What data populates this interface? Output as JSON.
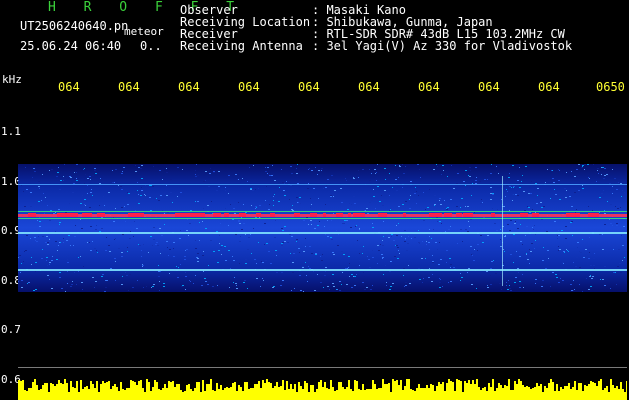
{
  "header": {
    "app_name": "H R O F F T",
    "filename": "UT2506240640.pn",
    "meteor_label": "meteor",
    "date_time": "25.06.24 06:40",
    "count_text": "0..",
    "fields": [
      {
        "label": "Observer",
        "value": ": Masaki Kano"
      },
      {
        "label": "Receiving Location",
        "value": ": Shibukawa, Gunma, Japan"
      },
      {
        "label": "Receiver",
        "value": ": RTL-SDR SDR# 43dB L15 103.2MHz CW"
      },
      {
        "label": "Receiving Antenna",
        "value": ": 3el Yagi(V) Az 330 for Vladivostok"
      }
    ]
  },
  "axes": {
    "y_unit": "kHz",
    "y_ticks": [
      "1.1",
      "1.0",
      "0.9",
      "0.8",
      "0.7",
      "0.6"
    ],
    "time_ticks": [
      "064",
      "064",
      "064",
      "064",
      "064",
      "064",
      "064",
      "064",
      "064",
      "0650"
    ]
  },
  "colors": {
    "background": "#000000",
    "header_title": "#3bd13b",
    "header_text": "#ffffff",
    "time_ticks": "#ffff33",
    "spectrum_fill": "#ffff00",
    "waterfall_base": "#0a1a7a",
    "waterfall_mid": "#2a6bff",
    "signal_line": "#ff3355",
    "green_line": "#39e07a"
  }
}
